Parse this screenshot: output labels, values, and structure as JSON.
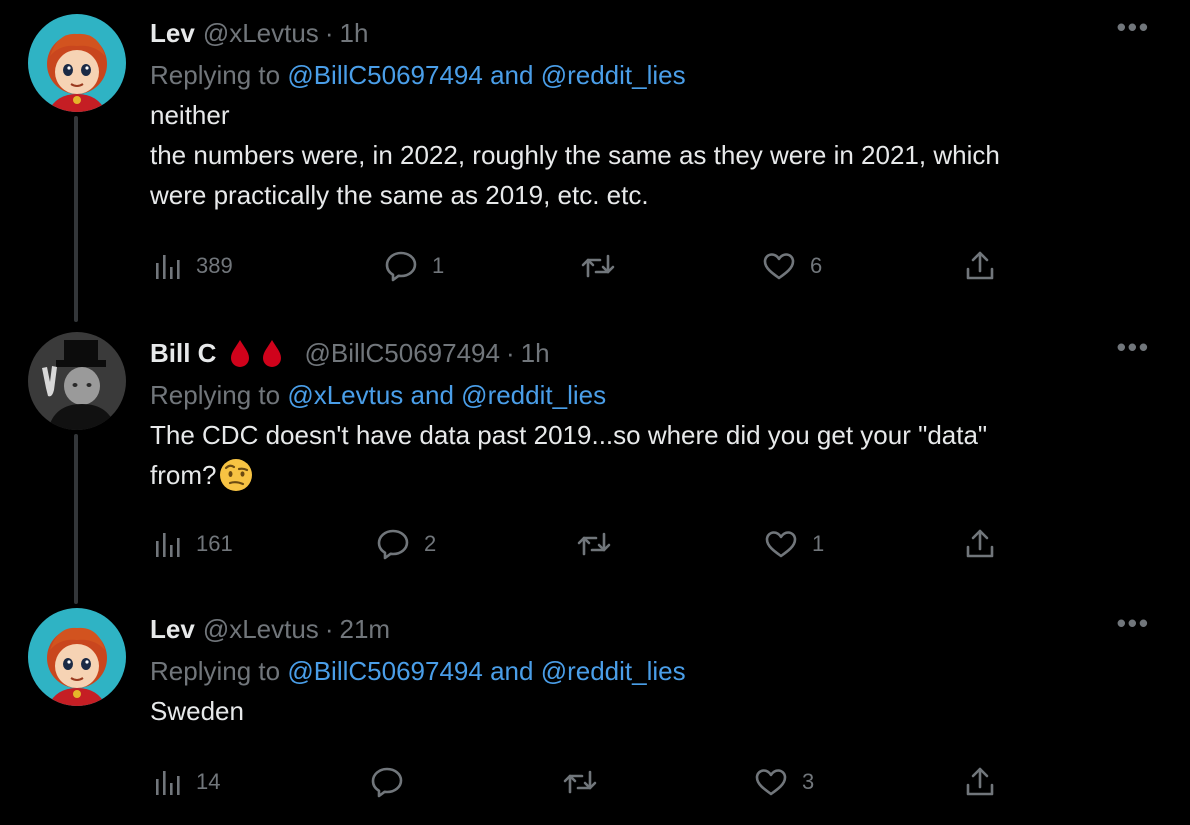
{
  "tweets": [
    {
      "name": "Lev",
      "handle": "@xLevtus",
      "dot": "·",
      "time": "1h",
      "replying_prefix": "Replying to",
      "mention1": "@BillC50697494",
      "mention_join": "and",
      "mention2": "@reddit_lies",
      "line1": "neither",
      "line2": "the numbers were, in 2022, roughly the same as they were in 2021, which",
      "line3": "were practically the same as 2019, etc. etc.",
      "views": "389",
      "replies": "1",
      "retweets": "",
      "likes": "6",
      "more": "•••"
    },
    {
      "name": "Bill C",
      "handle": "@BillC50697494",
      "dot": "·",
      "time": "1h",
      "replying_prefix": "Replying to",
      "mention1": "@xLevtus",
      "mention_join": "and",
      "mention2": "@reddit_lies",
      "line1": "The CDC doesn't have data past 2019...so where did you get your \"data\"",
      "line2": "from?",
      "emoji": "raised-eyebrow-emoji",
      "views": "161",
      "replies": "2",
      "retweets": "",
      "likes": "1",
      "more": "•••"
    },
    {
      "name": "Lev",
      "handle": "@xLevtus",
      "dot": "·",
      "time": "21m",
      "replying_prefix": "Replying to",
      "mention1": "@BillC50697494",
      "mention_join": "and",
      "mention2": "@reddit_lies",
      "line1": "Sweden",
      "views": "14",
      "replies": "",
      "retweets": "",
      "likes": "3",
      "more": "•••"
    }
  ],
  "colors": {
    "background": "#000000",
    "text": "#e7e9ea",
    "muted": "#71767b",
    "mention": "#4a9ee8",
    "blood_drop": "#d0021b"
  },
  "icons": [
    "views-icon",
    "reply-icon",
    "retweet-icon",
    "like-icon",
    "share-icon",
    "blood-drop-icon",
    "more-icon"
  ]
}
